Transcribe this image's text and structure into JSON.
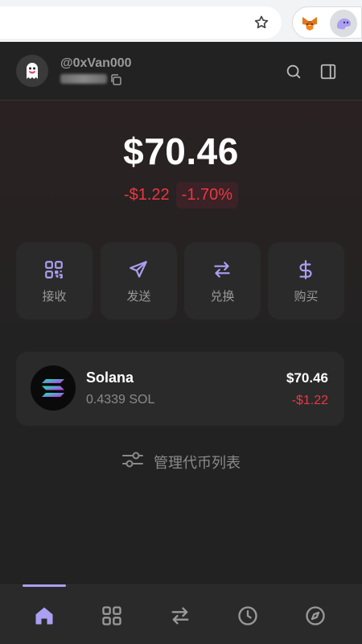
{
  "account": {
    "name": "@0xVan000"
  },
  "balance": {
    "total": "$70.46",
    "change_amount": "-$1.22",
    "change_percent": "-1.70%"
  },
  "actions": [
    {
      "label": "接收",
      "icon": "qr-code-icon"
    },
    {
      "label": "发送",
      "icon": "send-icon"
    },
    {
      "label": "兑换",
      "icon": "swap-icon"
    },
    {
      "label": "购买",
      "icon": "dollar-icon"
    }
  ],
  "tokens": [
    {
      "name": "Solana",
      "amount": "0.4339 SOL",
      "value": "$70.46",
      "change": "-$1.22"
    }
  ],
  "manage_label": "管理代币列表",
  "bottom_nav": [
    "home-icon",
    "apps-grid-icon",
    "swap-icon",
    "history-icon",
    "explore-compass-icon"
  ],
  "colors": {
    "accent": "#ab9ff2",
    "negative": "#eb3742",
    "background": "#222222",
    "card": "#2a2a2a"
  }
}
